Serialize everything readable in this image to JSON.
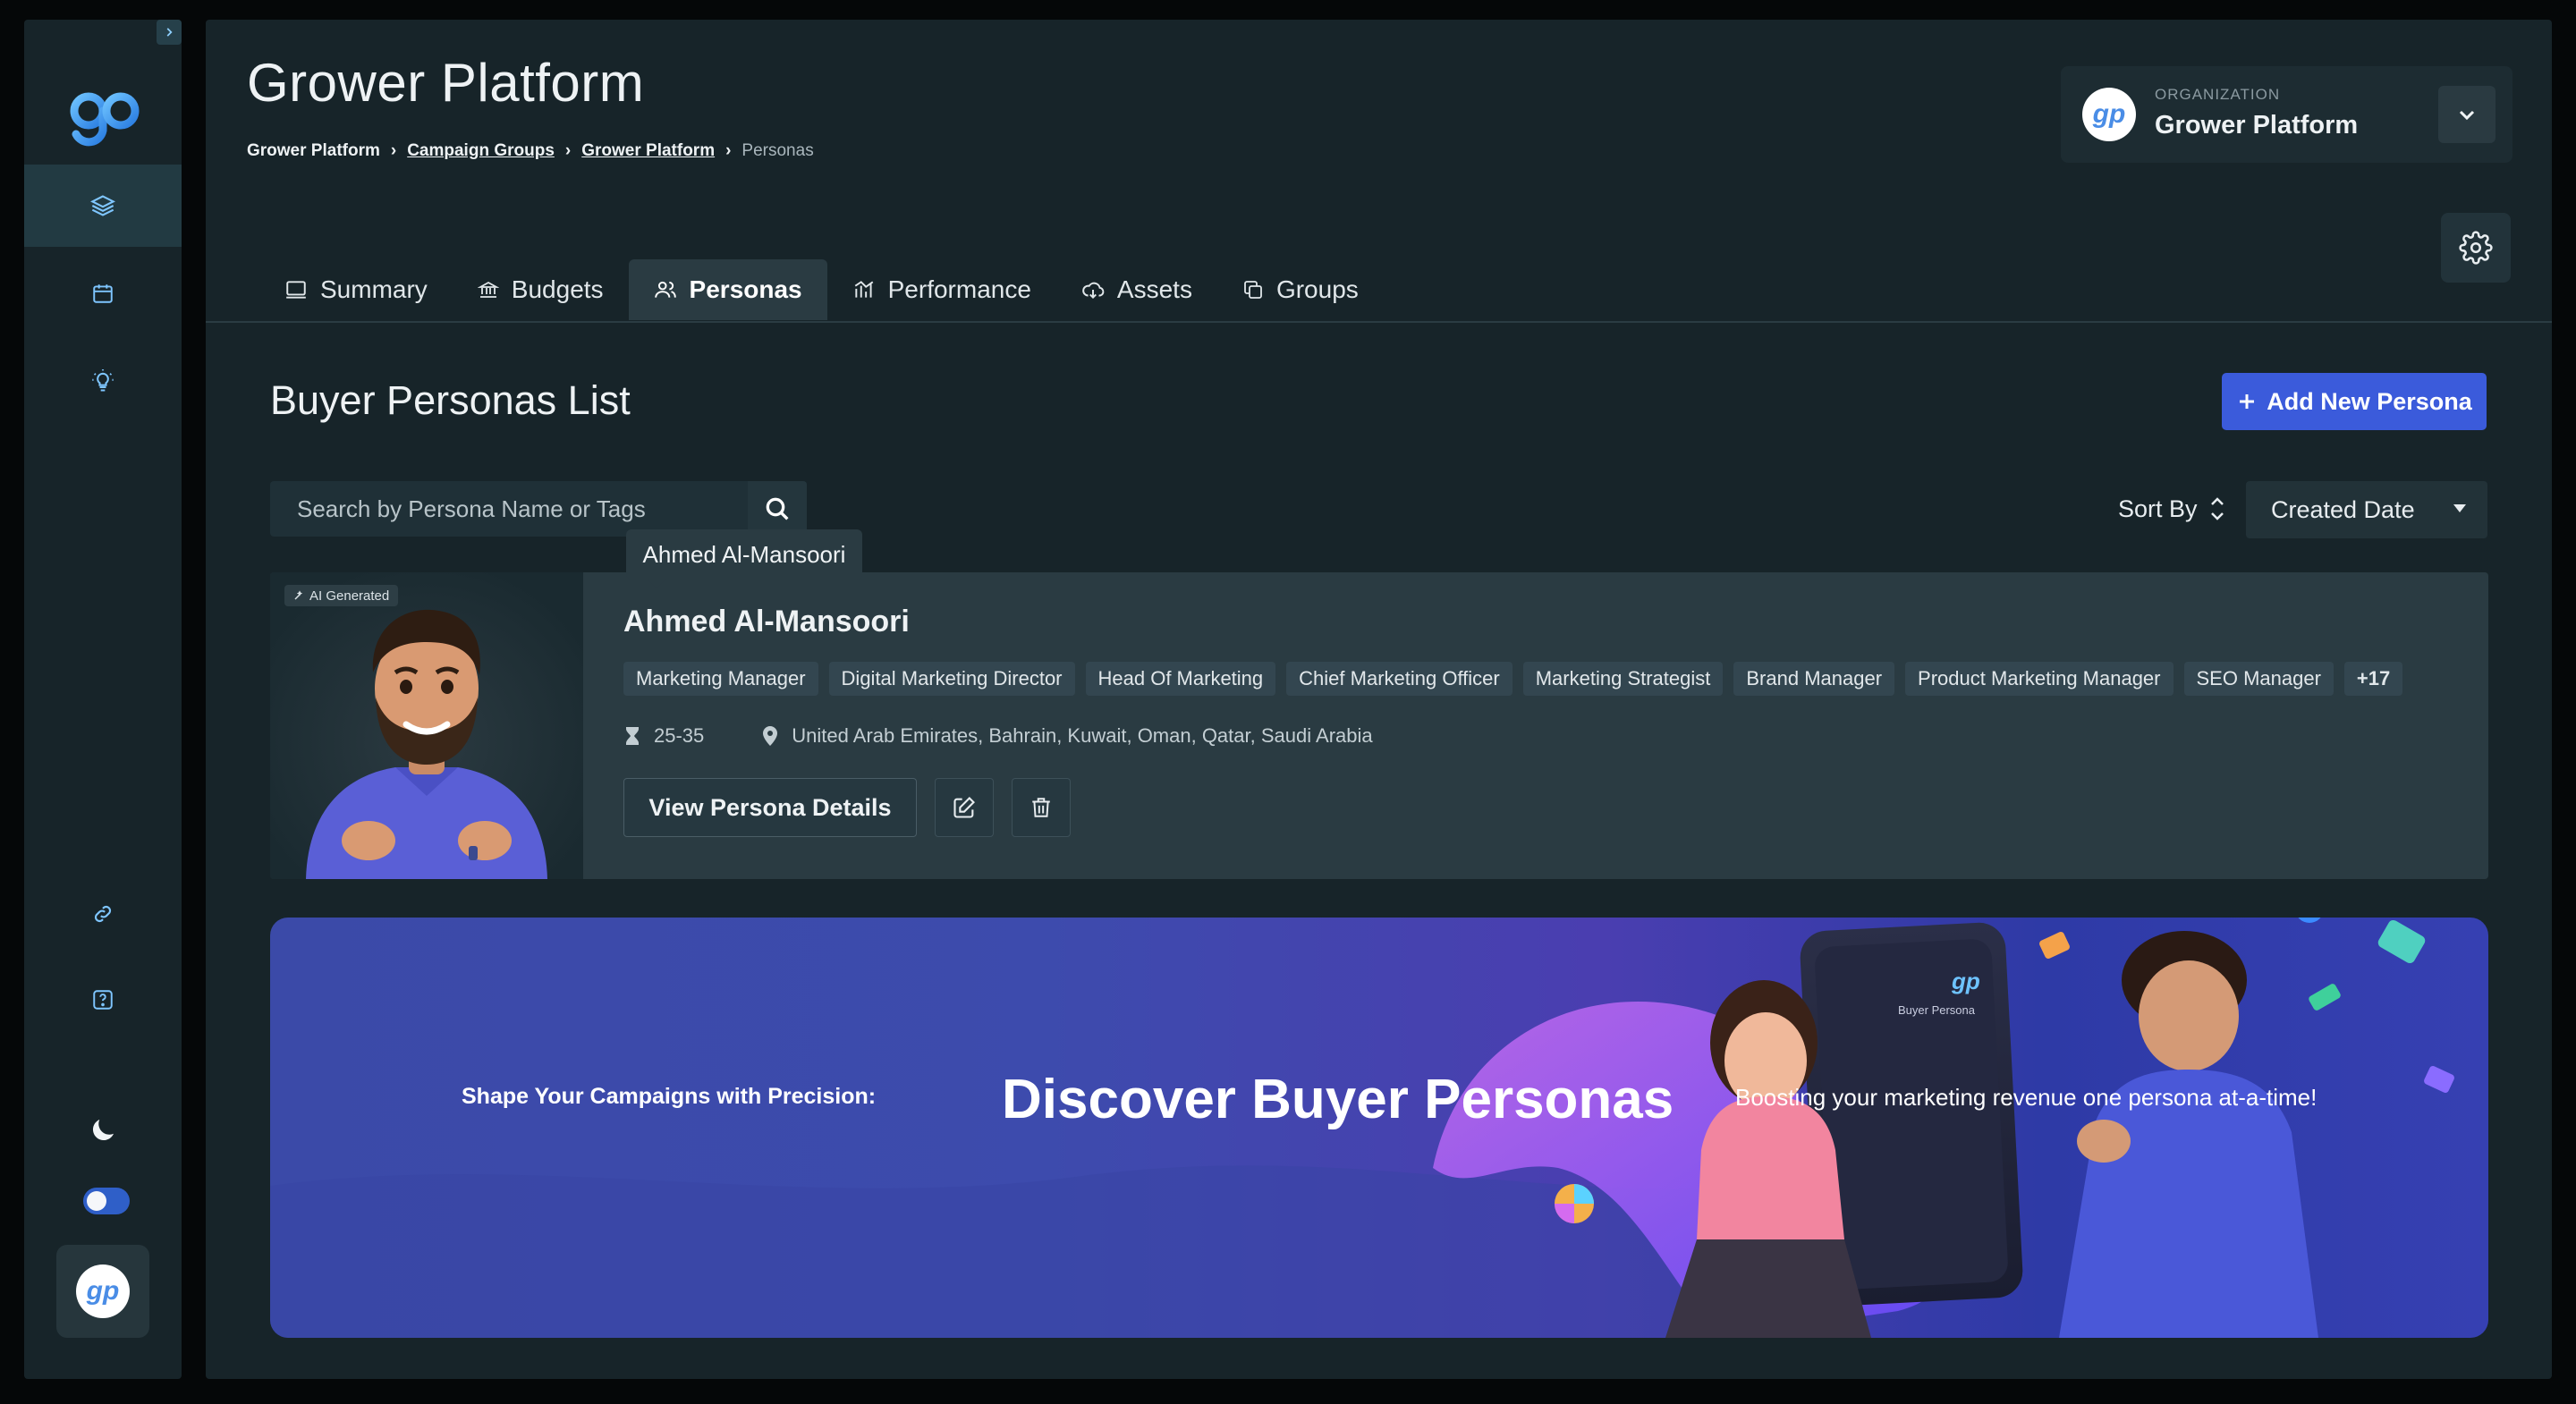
{
  "sidebar": {
    "items": [
      {
        "name": "layers",
        "active": true
      },
      {
        "name": "calendar",
        "active": false
      },
      {
        "name": "lightbulb",
        "active": false
      },
      {
        "name": "link",
        "active": false
      },
      {
        "name": "help",
        "active": false
      }
    ],
    "logo_text": "gp",
    "avatar_text": "gp"
  },
  "header": {
    "title": "Grower Platform",
    "breadcrumb": {
      "root": "Grower Platform",
      "campaign_groups": "Campaign Groups",
      "platform": "Grower Platform",
      "current": "Personas"
    }
  },
  "organization": {
    "label": "ORGANIZATION",
    "name": "Grower Platform",
    "logo_text": "gp"
  },
  "tabs": [
    {
      "label": "Summary",
      "icon": "monitor-icon"
    },
    {
      "label": "Budgets",
      "icon": "bank-icon"
    },
    {
      "label": "Personas",
      "icon": "users-icon"
    },
    {
      "label": "Performance",
      "icon": "chart-icon"
    },
    {
      "label": "Assets",
      "icon": "cloud-icon"
    },
    {
      "label": "Groups",
      "icon": "copy-icon"
    }
  ],
  "main": {
    "list_title": "Buyer Personas List",
    "add_button": "Add New Persona",
    "search_placeholder": "Search by Persona Name or Tags",
    "sort_label": "Sort By",
    "sort_value": "Created Date",
    "tooltip": "Ahmed Al-Mansoori"
  },
  "persona": {
    "badge": "AI Generated",
    "name": "Ahmed Al-Mansoori",
    "tags": [
      "Marketing Manager",
      "Digital Marketing Director",
      "Head Of Marketing",
      "Chief Marketing Officer",
      "Marketing Strategist",
      "Brand Manager",
      "Product Marketing Manager",
      "SEO Manager"
    ],
    "more_tags": "+17",
    "age": "25-35",
    "locations": "United Arab Emirates, Bahrain, Kuwait, Oman, Qatar, Saudi Arabia",
    "view_button": "View Persona Details"
  },
  "banner": {
    "subtitle": "Shape Your Campaigns with Precision:",
    "title": "Discover Buyer Personas",
    "tagline": "Boosting your marketing revenue one persona at-a-time!",
    "phone_label": "Buyer Persona",
    "phone_logo": "gp"
  },
  "colors": {
    "accent": "#3b5bdb",
    "panel": "#172429",
    "card": "#2a3b42"
  }
}
